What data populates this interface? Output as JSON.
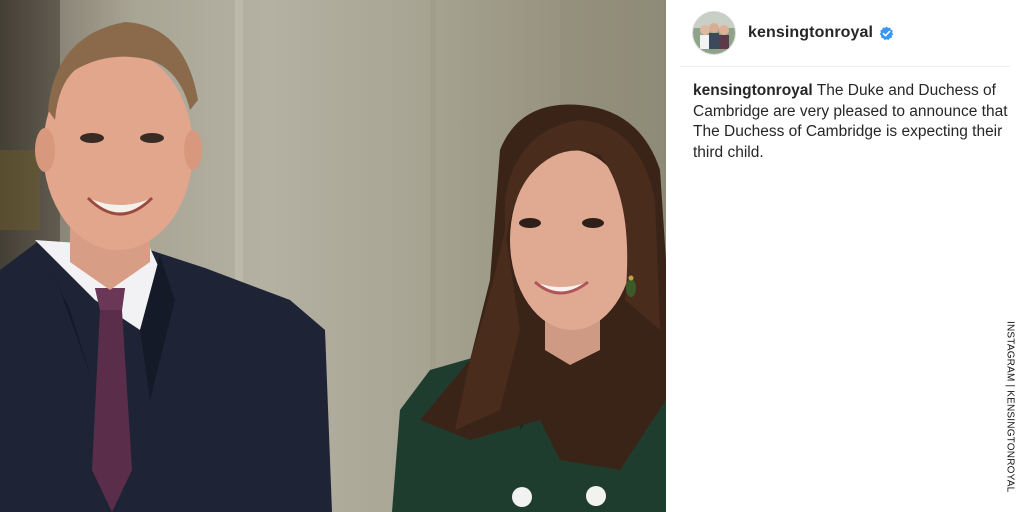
{
  "post": {
    "username": "kensingtonroyal",
    "caption_username": "kensingtonroyal",
    "caption_text": "The Duke and Duchess of Cambridge are very pleased to announce that The Duchess of Cambridge is expecting their third child."
  },
  "photo_credit": "INSTAGRAM | KENSINGTONROYAL",
  "icons": {
    "verified": "verified-badge-icon"
  },
  "colors": {
    "verified_blue": "#3897f0",
    "text": "#262626",
    "divider": "#efefef"
  }
}
